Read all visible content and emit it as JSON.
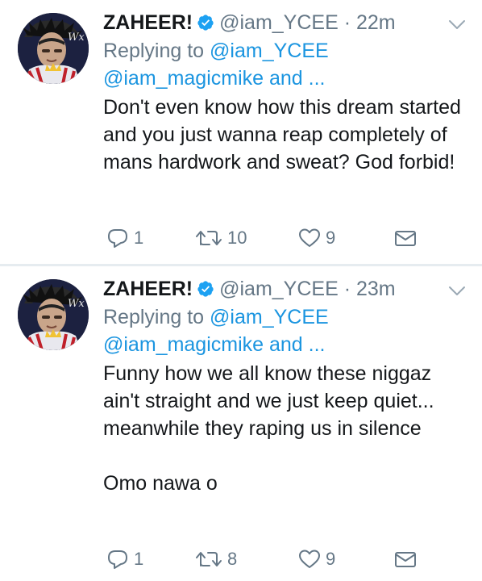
{
  "colors": {
    "link": "#1b95e0",
    "text": "#14171a",
    "muted": "#657786",
    "verified": "#1da1f2",
    "divider": "#e6ecf0"
  },
  "tweets": [
    {
      "name": "ZAHEER!",
      "handle": "@iam_YCEE",
      "dot": "·",
      "time": "22m",
      "replying_prefix": "Replying to ",
      "replying_to_1": "@iam_YCEE",
      "replying_to_2": "@iam_magicmike",
      "replying_suffix": " and ...",
      "text": "Don't even know how this dream started and you just wanna reap completely of mans hardwork and sweat? God forbid!",
      "replies": "1",
      "retweets": "10",
      "likes": "9"
    },
    {
      "name": "ZAHEER!",
      "handle": "@iam_YCEE",
      "dot": "·",
      "time": "23m",
      "replying_prefix": "Replying to ",
      "replying_to_1": "@iam_YCEE",
      "replying_to_2": "@iam_magicmike",
      "replying_suffix": " and ...",
      "text": "Funny how we all know these niggaz ain't straight and we just keep quiet... meanwhile they raping us in silence\n\nOmo nawa o",
      "replies": "1",
      "retweets": "8",
      "likes": "9"
    }
  ],
  "icons": {
    "verified": "verified-badge-icon",
    "caret": "chevron-down-icon",
    "reply": "reply-icon",
    "retweet": "retweet-icon",
    "like": "heart-icon",
    "dm": "envelope-icon"
  }
}
